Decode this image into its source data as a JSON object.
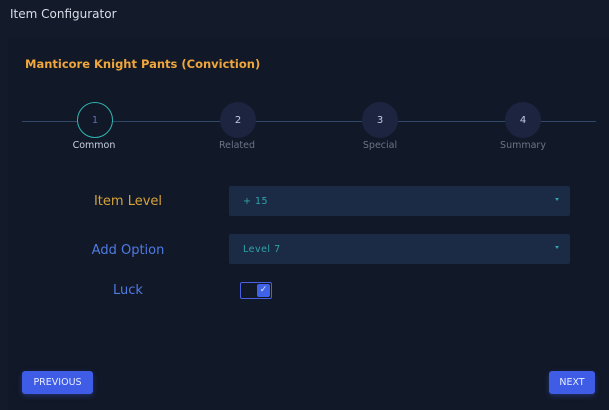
{
  "window": {
    "title": "Item Configurator"
  },
  "item": {
    "name": "Manticore Knight Pants (Conviction)"
  },
  "stepper": {
    "active_index": 0,
    "steps": [
      {
        "number": "1",
        "label": "Common"
      },
      {
        "number": "2",
        "label": "Related"
      },
      {
        "number": "3",
        "label": "Special"
      },
      {
        "number": "4",
        "label": "Summary"
      }
    ]
  },
  "form": {
    "item_level": {
      "label": "Item Level",
      "value": "+ 15"
    },
    "add_option": {
      "label": "Add Option",
      "value": "Level 7"
    },
    "luck": {
      "label": "Luck",
      "checked": true,
      "check_glyph": "✓"
    }
  },
  "buttons": {
    "previous": "PREVIOUS",
    "next": "NEXT"
  },
  "colors": {
    "accent": "#3f5ce6",
    "item_name": "#f0a63c",
    "label_orange": "#d6a33a",
    "label_blue": "#4f7be3",
    "teal": "#2fb5b2"
  }
}
